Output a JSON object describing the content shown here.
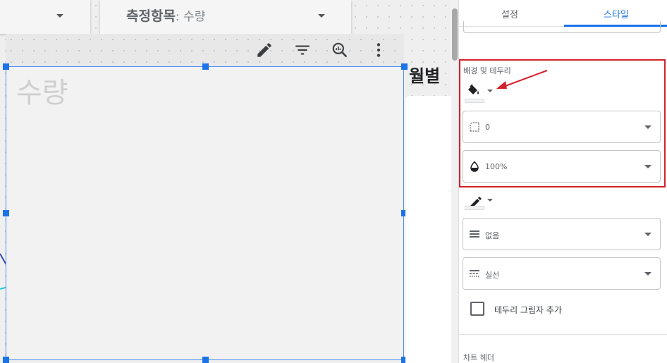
{
  "canvas": {
    "metric_control": {
      "key": "측정항목",
      "value": ": 수량"
    },
    "chart": {
      "title": "수량"
    },
    "right_chart_title": "월별"
  },
  "toolbar": {
    "icons": [
      "edit-pencil-icon",
      "filter-icon",
      "zoom-chart-icon",
      "more-vert-icon"
    ]
  },
  "panel": {
    "tabs": {
      "setup": "설정",
      "style": "스타일",
      "active": "style"
    },
    "background_border": {
      "title": "배경 및 테두리",
      "fill_color_icon": "paint-bucket-icon",
      "corner_radius": "0",
      "opacity": "100%"
    },
    "border": {
      "color_icon": "pencil-icon",
      "weight": "없음",
      "style": "실선",
      "shadow_label": "테두리 그림자 추가",
      "shadow_checked": false
    },
    "next_section_title": "차트 헤더"
  },
  "colors": {
    "accent": "#1a73e8",
    "highlight": "#d3222a",
    "canvas_bg": "#efefef"
  }
}
